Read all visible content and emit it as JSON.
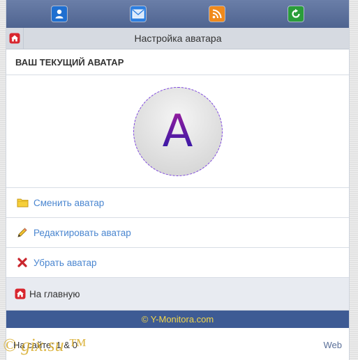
{
  "topnav": {
    "icons": [
      {
        "name": "user-icon",
        "color": "#1f6fd0"
      },
      {
        "name": "mail-icon",
        "color": "#2d7fe0"
      },
      {
        "name": "rss-icon",
        "color": "#f08a1c"
      },
      {
        "name": "refresh-icon",
        "color": "#2a9d3a"
      }
    ]
  },
  "header": {
    "title": "Настройка аватара"
  },
  "section": {
    "title": "ВАШ ТЕКУЩИЙ АВАТАР"
  },
  "avatar": {
    "letter": "A"
  },
  "menu": {
    "items": [
      {
        "label": "Сменить аватар",
        "icon": "folder-icon"
      },
      {
        "label": "Редактировать аватар",
        "icon": "pencil-icon"
      },
      {
        "label": "Убрать аватар",
        "icon": "remove-icon"
      }
    ]
  },
  "home_link": {
    "label": "На главную"
  },
  "footer": {
    "copyright": "© Y-Monitora.com"
  },
  "status": {
    "online": "На сайте: 1 & 0",
    "web": "Web"
  },
  "watermark": {
    "text": "© gix.su ™"
  },
  "colors": {
    "accent": "#4a86d0",
    "footer_bg": "#3e5b94",
    "footer_text": "#f2d64a",
    "avatar_border": "#7a3fe0"
  }
}
